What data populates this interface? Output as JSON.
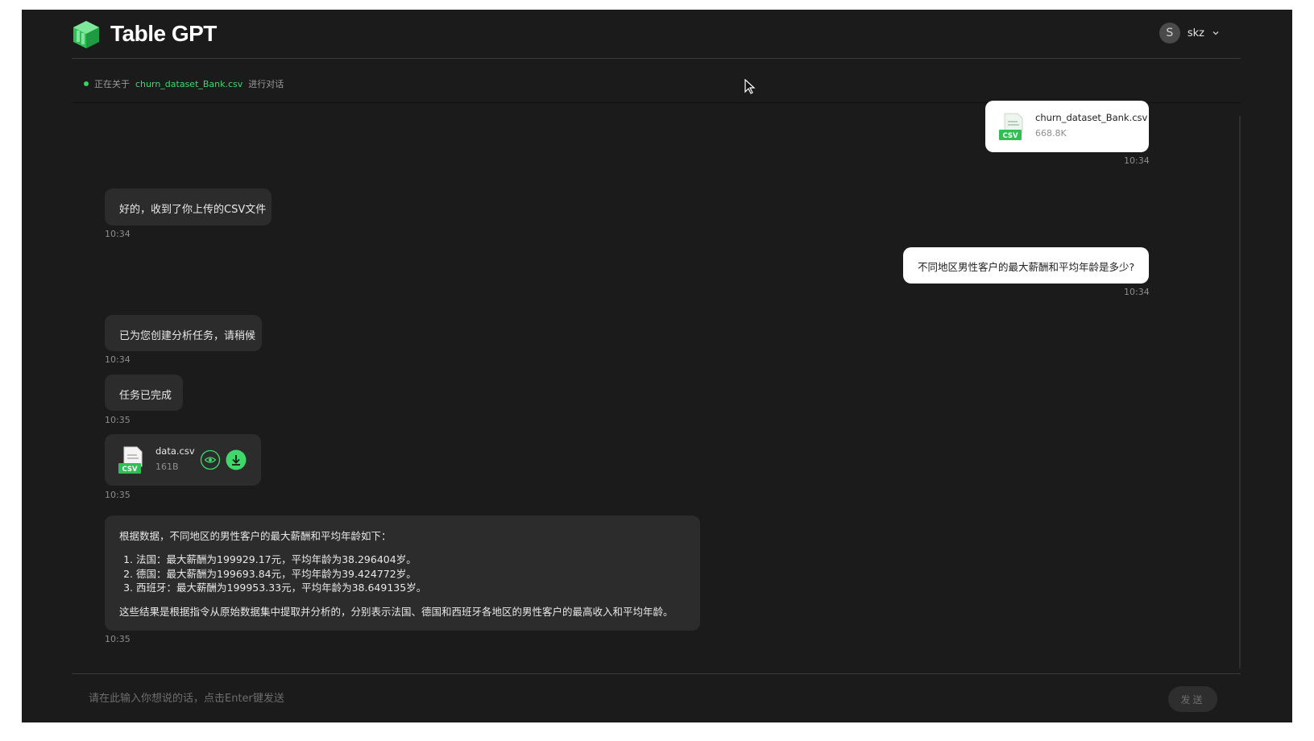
{
  "header": {
    "brand": "Table GPT",
    "user": {
      "avatar_letter": "S",
      "name": "skz"
    }
  },
  "context": {
    "prefix": "正在关于",
    "file": "churn_dataset_Bank.csv",
    "suffix": "进行对话"
  },
  "messages": {
    "upload": {
      "file_name": "churn_dataset_Bank.csv",
      "file_size": "668.8K",
      "file_type": "CSV",
      "time": "10:34"
    },
    "bot_received": {
      "text": "好的，收到了你上传的CSV文件",
      "time": "10:34"
    },
    "user_question": {
      "text": "不同地区男性客户的最大薪酬和平均年龄是多少?",
      "time": "10:34"
    },
    "bot_task_created": {
      "text": "已为您创建分析任务，请稍候",
      "time": "10:34"
    },
    "bot_task_done": {
      "text": "任务已完成",
      "time": "10:35"
    },
    "result_file": {
      "file_name": "data.csv",
      "file_size": "161B",
      "file_type": "CSV",
      "time": "10:35"
    },
    "answer": {
      "intro": "根据数据，不同地区的男性客户的最大薪酬和平均年龄如下：",
      "items": [
        "法国：最大薪酬为199929.17元，平均年龄为38.296404岁。",
        "德国：最大薪酬为199693.84元，平均年龄为39.424772岁。",
        "西班牙：最大薪酬为199953.33元，平均年龄为38.649135岁。"
      ],
      "conclusion": "这些结果是根据指令从原始数据集中提取并分析的，分别表示法国、德国和西班牙各地区的男性客户的最高收入和平均年龄。",
      "time": "10:35"
    }
  },
  "input": {
    "placeholder": "请在此输入你想说的话，点击Enter键发送",
    "send_label": "发送"
  },
  "colors": {
    "accent": "#3fd86a",
    "background": "#1b1b1b",
    "bot_bubble": "#2c2c2c",
    "user_bubble": "#ffffff"
  }
}
